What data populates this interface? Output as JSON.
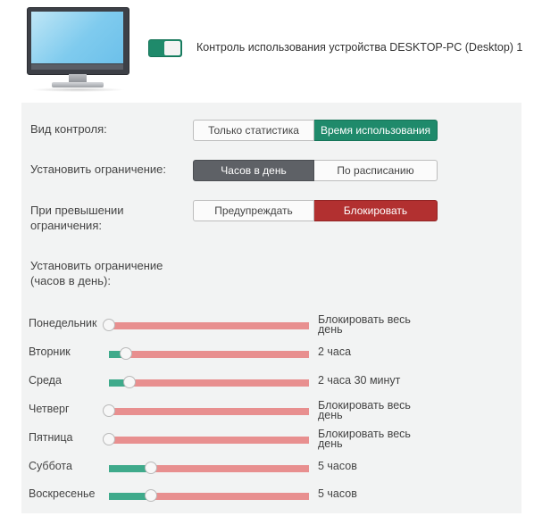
{
  "header": {
    "device_title": "Контроль использования устройства DESKTOP-PC (Desktop) 1",
    "toggle_on": true
  },
  "control_type": {
    "label": "Вид контроля:",
    "options": [
      "Только статистика",
      "Время использования"
    ],
    "selected": "Время использования"
  },
  "limit": {
    "label": "Установить ограничение:",
    "options": [
      "Часов в день",
      "По расписанию"
    ],
    "selected": "Часов в день"
  },
  "exceed": {
    "label_line1": "При превышении",
    "label_line2": "ограничения:",
    "options": [
      "Предупреждать",
      "Блокировать"
    ],
    "selected": "Блокировать"
  },
  "hours_section": {
    "label_line1": "Установить ограничение",
    "label_line2": "(часов в день):"
  },
  "days": [
    {
      "name": "Понедельник",
      "value_line1": "Блокировать весь",
      "value_line2": "день",
      "level": 0.0
    },
    {
      "name": "Вторник",
      "value_line1": "2 часа",
      "value_line2": "",
      "level": 0.083
    },
    {
      "name": "Среда",
      "value_line1": "2 часа 30 минут",
      "value_line2": "",
      "level": 0.104
    },
    {
      "name": "Четверг",
      "value_line1": "Блокировать весь",
      "value_line2": "день",
      "level": 0.0
    },
    {
      "name": "Пятница",
      "value_line1": "Блокировать весь",
      "value_line2": "день",
      "level": 0.0
    },
    {
      "name": "Суббота",
      "value_line1": "5 часов",
      "value_line2": "",
      "level": 0.208
    },
    {
      "name": "Воскресенье",
      "value_line1": "5 часов",
      "value_line2": "",
      "level": 0.208
    }
  ],
  "colors": {
    "accent_green": "#1f8a6b",
    "slider_fill": "#3faa8b",
    "slider_track": "#e88f8f",
    "block_red": "#b23030",
    "selected_dark": "#5e6166"
  }
}
